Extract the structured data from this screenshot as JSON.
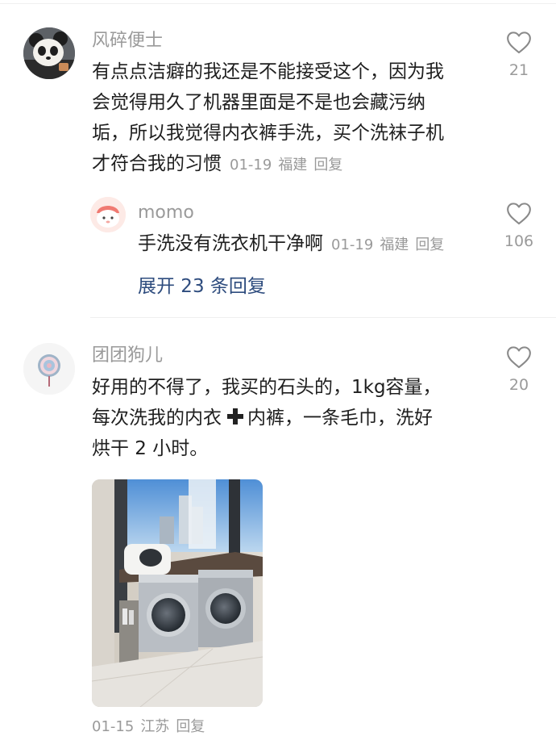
{
  "comments": [
    {
      "username": "风碎便士",
      "lines": [
        "有点点洁癖的我还是不能接受这个，因为我",
        "会觉得用久了机器里面是不是也会藏污纳",
        "垢，所以我觉得内衣裤手洗，买个洗袜子机",
        "才符合我的习惯"
      ],
      "date": "01-19",
      "location": "福建",
      "reply_label": "回复",
      "likes": "21",
      "reply": {
        "username": "momo",
        "text": "手洗没有洗衣机干净啊",
        "date": "01-19",
        "location": "福建",
        "reply_label": "回复",
        "likes": "106"
      },
      "expand_label": "展开 23 条回复"
    },
    {
      "username": "团团狗儿",
      "lines": [
        "好用的不得了，我买的石头的，1kg容量，",
        "每次洗我的内衣",
        "内裤，一条毛巾，洗好",
        "烘干 2 小时。"
      ],
      "plus_icon": "heavy-plus-icon",
      "image": "photo of two front-loading washing machines by a window",
      "date": "01-15",
      "location": "江苏",
      "reply_label": "回复",
      "likes": "20"
    }
  ],
  "icons": {
    "like": "heart-outline-icon"
  },
  "colors": {
    "link": "#2e4c7e",
    "meta": "#9a9a9a",
    "text": "#1f1f1f"
  }
}
